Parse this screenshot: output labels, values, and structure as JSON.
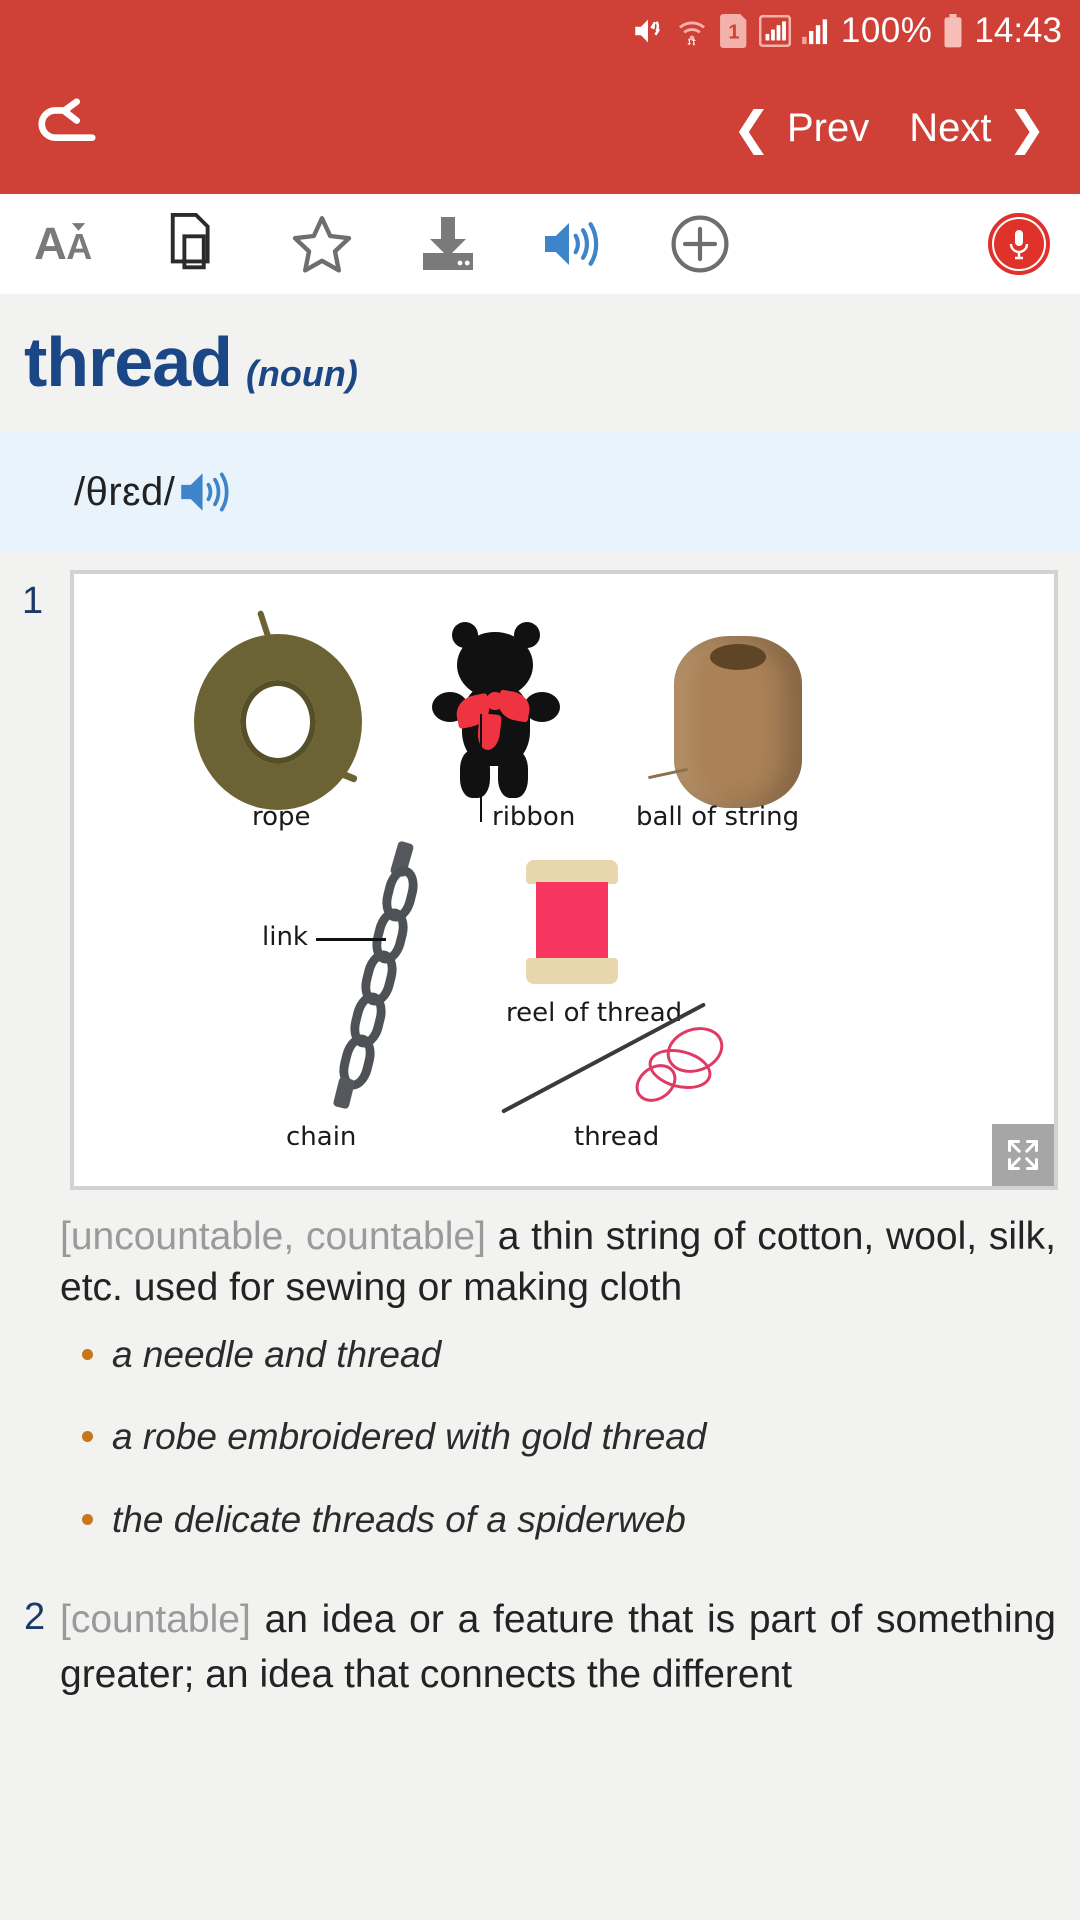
{
  "status_bar": {
    "mute_icon": "mute-icon",
    "wifi_icon": "wifi-icon",
    "sim_icon": "sim-1-icon",
    "signal_icon_1": "signal-bars-icon",
    "signal_icon_2": "signal-bars-icon",
    "battery_percent": "100%",
    "battery_icon": "battery-full-icon",
    "time": "14:43"
  },
  "navbar": {
    "back_icon": "back-arrow-icon",
    "prev_label": "Prev",
    "next_label": "Next",
    "prev_chevron": "❮",
    "next_chevron": "❯",
    "background_color": "#cf4036"
  },
  "toolbar": {
    "items": [
      {
        "name": "font-size-icon",
        "label": "AĂ"
      },
      {
        "name": "copy-icon",
        "label": ""
      },
      {
        "name": "favorite-star-icon",
        "label": ""
      },
      {
        "name": "download-icon",
        "label": ""
      },
      {
        "name": "audio-speaker-icon",
        "label": ""
      },
      {
        "name": "add-circle-icon",
        "label": ""
      }
    ],
    "mic_button": "microphone-record-button"
  },
  "entry": {
    "headword": "thread",
    "part_of_speech": "(noun)",
    "headword_color": "#1c4787",
    "phonetic": "/θrɛd/",
    "phonetic_audio_icon": "audio-speaker-icon"
  },
  "illustration": {
    "sense_number": "1",
    "expand_icon": "expand-fullscreen-icon",
    "labels": [
      {
        "text": "rope"
      },
      {
        "text": "ribbon"
      },
      {
        "text": "ball of string"
      },
      {
        "text": "link"
      },
      {
        "text": "reel of thread"
      },
      {
        "text": "chain"
      },
      {
        "text": "thread"
      }
    ]
  },
  "senses": [
    {
      "number": "1",
      "grammar": "[uncountable, countable]",
      "definition": "a thin string of cotton, wool, silk, etc. used for sewing or making cloth",
      "examples": [
        "a needle and thread",
        "a robe embroidered with gold thread",
        "the delicate threads of a spiderweb"
      ]
    },
    {
      "number": "2",
      "grammar": "[countable]",
      "definition": "an idea or a feature that is part of something greater; an idea that connects the different",
      "examples": []
    }
  ],
  "colors": {
    "brand_red": "#cf4036",
    "headword_blue": "#1c4787",
    "phonetic_bg": "#e9f3fc",
    "page_bg": "#f2f2f0",
    "bullet_orange": "#c8761b",
    "grammar_gray": "#9a9a9a"
  }
}
